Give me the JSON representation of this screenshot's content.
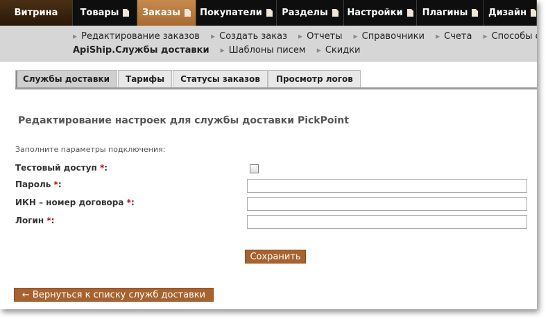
{
  "topnav": {
    "items": [
      {
        "label": "Витрина"
      },
      {
        "label": "Товары"
      },
      {
        "label": "Заказы"
      },
      {
        "label": "Покупатели"
      },
      {
        "label": "Разделы"
      },
      {
        "label": "Настройки"
      },
      {
        "label": "Плагины"
      },
      {
        "label": "Дизайн"
      }
    ],
    "active": "Заказы"
  },
  "submenu": {
    "row1": [
      "Редактирование заказов",
      "Создать заказ",
      "Отчеты",
      "Справочники",
      "Счета",
      "Способы оп"
    ],
    "current": "ApiShip.Службы доставки",
    "row2": [
      "Шаблоны писем",
      "Скидки"
    ]
  },
  "tabs": [
    "Службы доставки",
    "Тарифы",
    "Статусы заказов",
    "Просмотр логов"
  ],
  "page": {
    "title": "Редактирование настроек для службы доставки PickPoint",
    "hint": "Заполните параметры подключения:"
  },
  "form": {
    "required_mark": "*",
    "test_access_label": "Тестовый доступ",
    "password_label": "Пароль",
    "ikn_label": "ИКН – номер договора",
    "login_label": "Логин",
    "password_value": "",
    "ikn_value": "",
    "login_value": "",
    "test_access_checked": false
  },
  "buttons": {
    "save": "Сохранить",
    "back": "← Вернуться к списку служб доставки"
  },
  "colors": {
    "accent": "#a8622f",
    "nav_bg": "#0e0e0e",
    "required": "#d00000"
  }
}
